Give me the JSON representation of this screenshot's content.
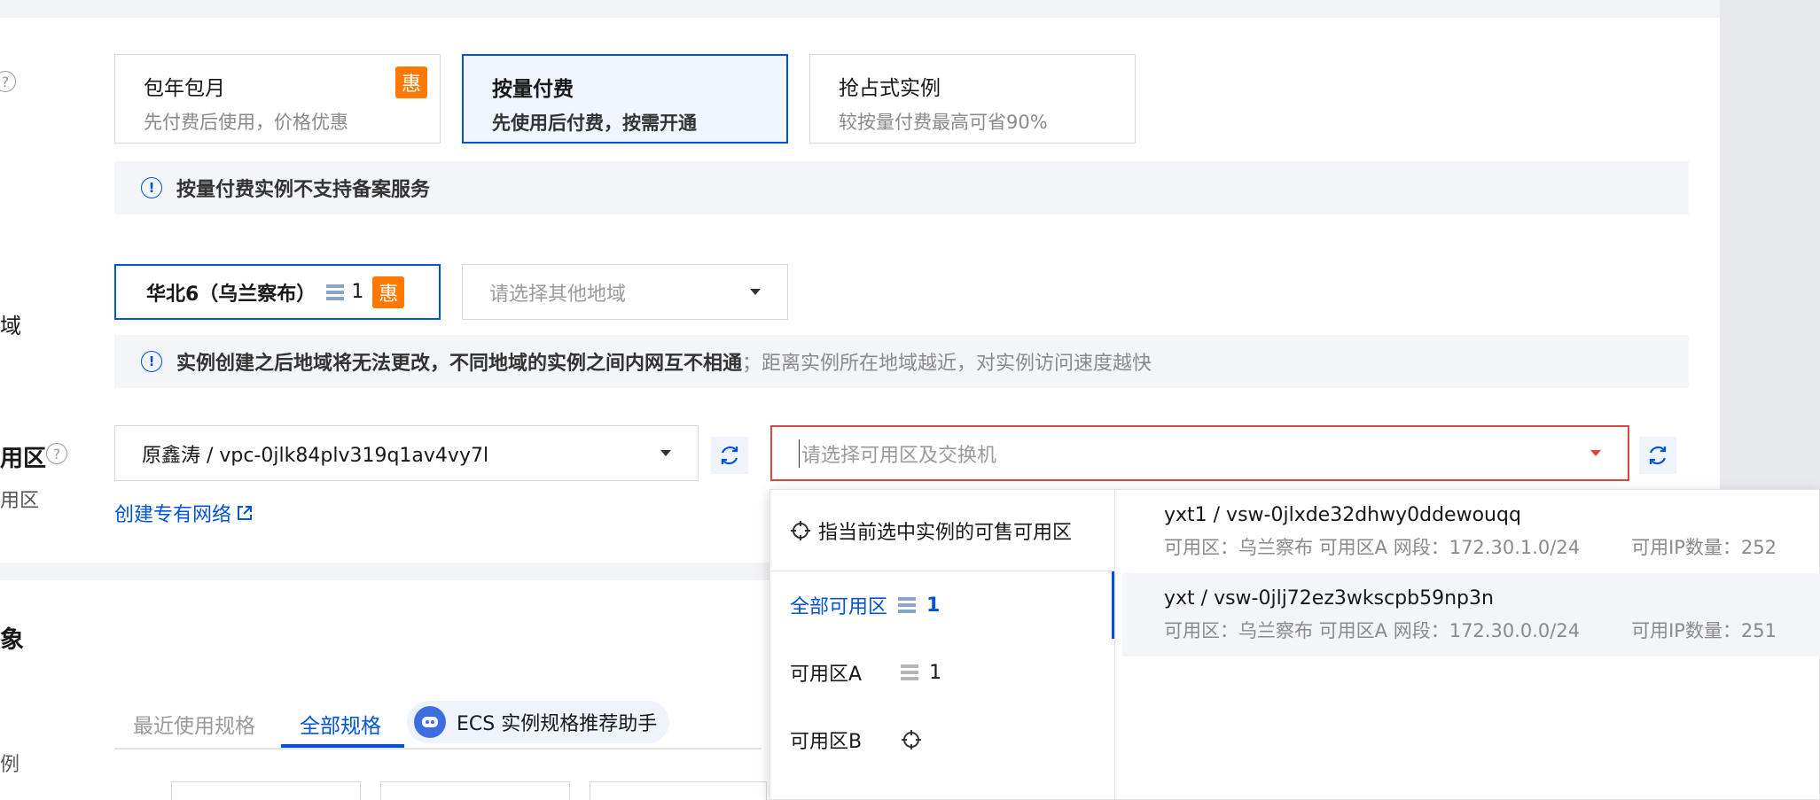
{
  "billing": {
    "options": [
      {
        "title": "包年包月",
        "subtitle": "先付费后使用，价格优惠",
        "badge": "惠"
      },
      {
        "title": "按量付费",
        "subtitle": "先使用后付费，按需开通",
        "selected": true
      },
      {
        "title": "抢占式实例",
        "subtitle": "较按量付费最高可省90%"
      }
    ],
    "notice": "按量付费实例不支持备案服务"
  },
  "region": {
    "label_cut": "域",
    "selected": "华北6（乌兰察布）",
    "count": "1",
    "badge": "惠",
    "other_placeholder": "请选择其他地域",
    "notice_bold": "实例创建之后地域将无法更改，不同地域的实例之间内网互不相通",
    "notice_rest": "；距离实例所在地域越近，对实例访问速度越快"
  },
  "network": {
    "label_cut": "用区",
    "sublabel_cut": "用区",
    "vpc_value": "原鑫涛 / vpc-0jlk84plv319q1av4vy7l",
    "zone_placeholder": "请选择可用区及交换机",
    "create_vpc_link": "创建专有网络"
  },
  "dropdown": {
    "hint": "指当前选中实例的可售可用区",
    "zones": [
      {
        "label": "全部可用区",
        "count": "1",
        "active": true
      },
      {
        "label": "可用区A",
        "count": "1"
      },
      {
        "label": "可用区B"
      }
    ],
    "switches": [
      {
        "name": "yxt1 / vsw-0jlxde32dhwy0ddewouqq",
        "detail": "可用区：乌兰察布 可用区A   网段：172.30.1.0/24",
        "ip": "可用IP数量：252"
      },
      {
        "name": "yxt / vsw-0jlj72ez3wkscpb59np3n",
        "detail": "可用区：乌兰察布 可用区A   网段：172.30.0.0/24",
        "ip": "可用IP数量：251"
      }
    ]
  },
  "spec": {
    "label_cut": "象",
    "label2_cut": "例",
    "tabs": [
      "最近使用规格",
      "全部规格"
    ],
    "assistant": "ECS 实例规格推荐助手"
  }
}
